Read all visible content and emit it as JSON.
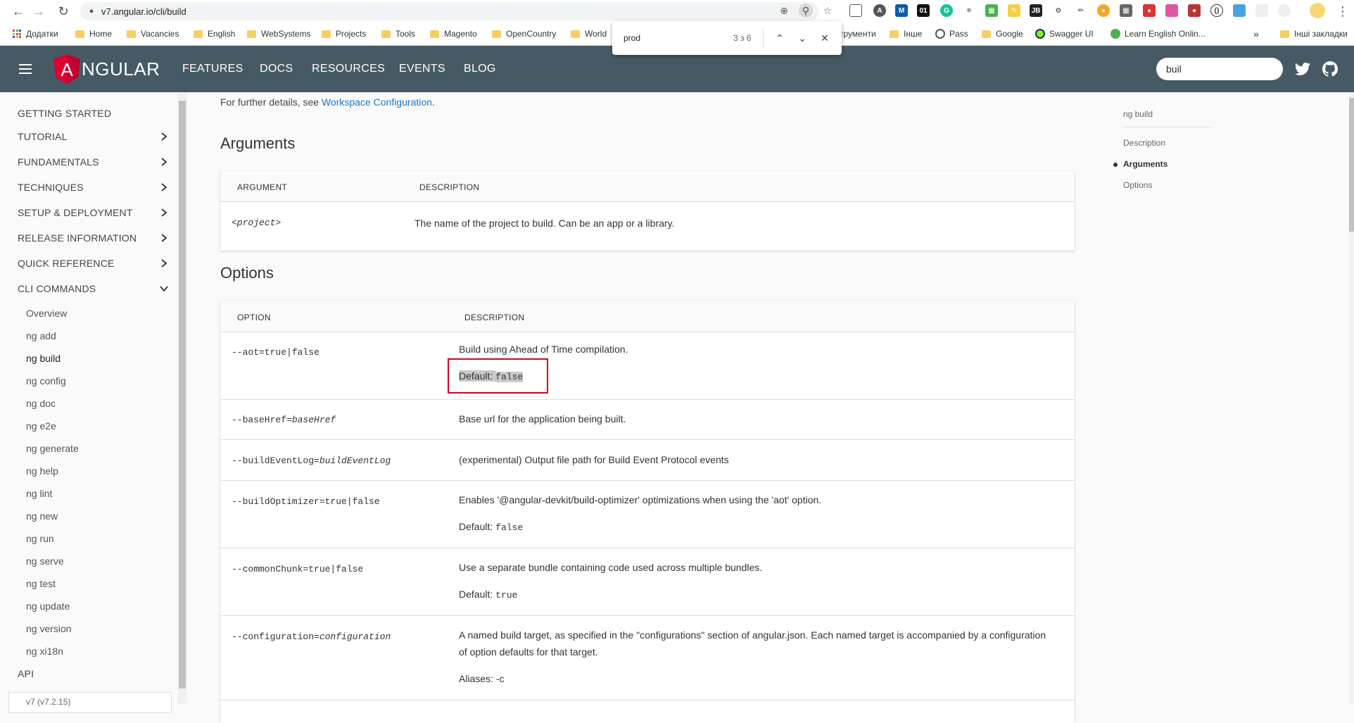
{
  "browser": {
    "url": "v7.angular.io/cli/build",
    "bookmarks": [
      {
        "label": "Додатки",
        "type": "apps"
      },
      {
        "label": "Home",
        "type": "folder"
      },
      {
        "label": "Vacancies",
        "type": "folder"
      },
      {
        "label": "English",
        "type": "folder"
      },
      {
        "label": "WebSystems",
        "type": "folder"
      },
      {
        "label": "Projects",
        "type": "folder"
      },
      {
        "label": "Tools",
        "type": "folder"
      },
      {
        "label": "Magento",
        "type": "folder"
      },
      {
        "label": "OpenCountry",
        "type": "folder"
      },
      {
        "label": "World",
        "type": "folder"
      },
      {
        "label": "трументи",
        "type": "folder"
      },
      {
        "label": "Інше",
        "type": "folder"
      },
      {
        "label": "Pass",
        "type": "site"
      },
      {
        "label": "Google",
        "type": "folder"
      },
      {
        "label": "Swagger UI",
        "type": "site"
      },
      {
        "label": "Learn English Onlin...",
        "type": "site"
      },
      {
        "label": "»",
        "type": "more"
      },
      {
        "label": "Інші закладки",
        "type": "folder"
      }
    ],
    "find": {
      "query": "prod",
      "count": "3 з 6"
    }
  },
  "header": {
    "logo_text": "NGULAR",
    "logo_letter": "A",
    "nav": [
      "FEATURES",
      "DOCS",
      "RESOURCES",
      "EVENTS",
      "BLOG"
    ],
    "search_value": "buil",
    "brand_color": "#455a64"
  },
  "sidebar": {
    "top_items": [
      {
        "label": "GETTING STARTED",
        "expandable": false
      },
      {
        "label": "TUTORIAL",
        "expandable": true
      },
      {
        "label": "FUNDAMENTALS",
        "expandable": true
      },
      {
        "label": "TECHNIQUES",
        "expandable": true
      },
      {
        "label": "SETUP & DEPLOYMENT",
        "expandable": true
      },
      {
        "label": "RELEASE INFORMATION",
        "expandable": true
      },
      {
        "label": "QUICK REFERENCE",
        "expandable": true
      },
      {
        "label": "CLI COMMANDS",
        "expandable": true,
        "expanded": true
      }
    ],
    "cli_items": [
      "Overview",
      "ng add",
      "ng build",
      "ng config",
      "ng doc",
      "ng e2e",
      "ng generate",
      "ng help",
      "ng lint",
      "ng new",
      "ng run",
      "ng serve",
      "ng test",
      "ng update",
      "ng version",
      "ng xi18n"
    ],
    "active_item": "ng build",
    "api_label": "API",
    "version": "v7 (v7.2.15)"
  },
  "content": {
    "further_prefix": "For further details, see ",
    "further_link": "Workspace Configuration",
    "further_suffix": ".",
    "arguments_title": "Arguments",
    "arguments_headers": [
      "ARGUMENT",
      "DESCRIPTION"
    ],
    "arguments_rows": [
      {
        "arg": "<project>",
        "desc": "The name of the project to build. Can be an app or a library."
      }
    ],
    "options_title": "Options",
    "options_headers": [
      "OPTION",
      "DESCRIPTION"
    ],
    "options_rows": [
      {
        "opt_prefix": "--aot=true|false",
        "opt_italic": "",
        "desc": "Build using Ahead of Time compilation.",
        "default_label": "Default: ",
        "default_value": "false"
      },
      {
        "opt_prefix": "--baseHref=",
        "opt_italic": "baseHref",
        "desc": "Base url for the application being built."
      },
      {
        "opt_prefix": "--buildEventLog=",
        "opt_italic": "buildEventLog",
        "desc": "(experimental) Output file path for Build Event Protocol events"
      },
      {
        "opt_prefix": "--buildOptimizer=true|false",
        "opt_italic": "",
        "desc": "Enables '@angular-devkit/build-optimizer' optimizations when using the 'aot' option.",
        "default_label": "Default: ",
        "default_value": "false"
      },
      {
        "opt_prefix": "--commonChunk=true|false",
        "opt_italic": "",
        "desc": "Use a separate bundle containing code used across multiple bundles.",
        "default_label": "Default: ",
        "default_value": "true"
      },
      {
        "opt_prefix": "--configuration=",
        "opt_italic": "configuration",
        "desc": "A named build target, as specified in the \"configurations\" section of angular.json. Each named target is accompanied by a configuration of option defaults for that target.",
        "aliases": "Aliases: -c"
      }
    ]
  },
  "toc": {
    "title": "ng build",
    "items": [
      "Description",
      "Arguments",
      "Options"
    ],
    "active": "Arguments"
  }
}
